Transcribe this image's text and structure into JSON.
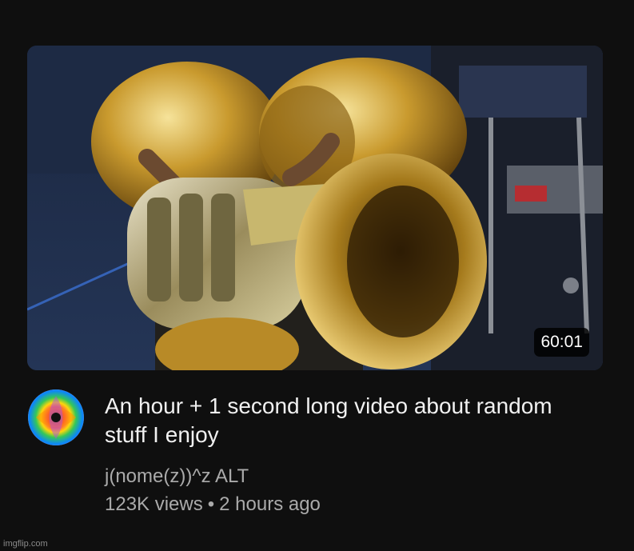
{
  "video": {
    "duration": "60:01",
    "title": "An hour + 1 second long video about random stuff I enjoy",
    "channel": "j(nome(z))^z ALT",
    "views": "123K views",
    "separator": "•",
    "age": "2 hours ago"
  },
  "thumbnail": {
    "subject": "tuba-player-photo",
    "icon": "tuba-image"
  },
  "avatar": {
    "icon": "fractal-avatar-icon"
  },
  "watermark": "imgflip.com",
  "colors": {
    "background": "#0f0f0f",
    "title": "#f1f1f1",
    "secondary_text": "#aaaaaa",
    "duration_bg": "#000000"
  }
}
